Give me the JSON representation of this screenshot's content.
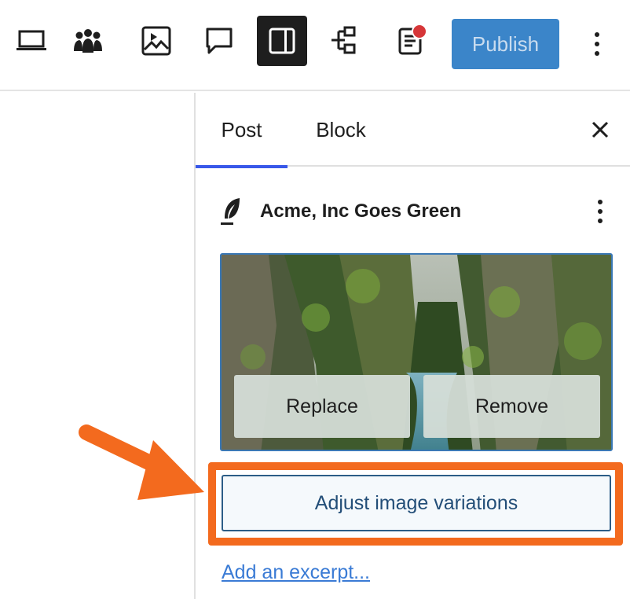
{
  "toolbar": {
    "icons": [
      "laptop-icon",
      "group-icon",
      "image-icon",
      "comment-icon",
      "sidebar-icon",
      "list-view-icon",
      "document-icon",
      "more-vertical-icon"
    ],
    "publish_label": "Publish",
    "colors": {
      "publish": "#3b85c9",
      "active": "#1e1e1e",
      "notification": "#d63638"
    }
  },
  "sidebar": {
    "tabs": [
      {
        "label": "Post",
        "active": true
      },
      {
        "label": "Block",
        "active": false
      }
    ],
    "post_title": "Acme, Inc Goes Green",
    "featured_image": {
      "replace_label": "Replace",
      "remove_label": "Remove"
    },
    "adjust_label": "Adjust image variations",
    "excerpt_link": "Add an excerpt..."
  },
  "annotation": {
    "highlight_color": "#f36a1e"
  }
}
